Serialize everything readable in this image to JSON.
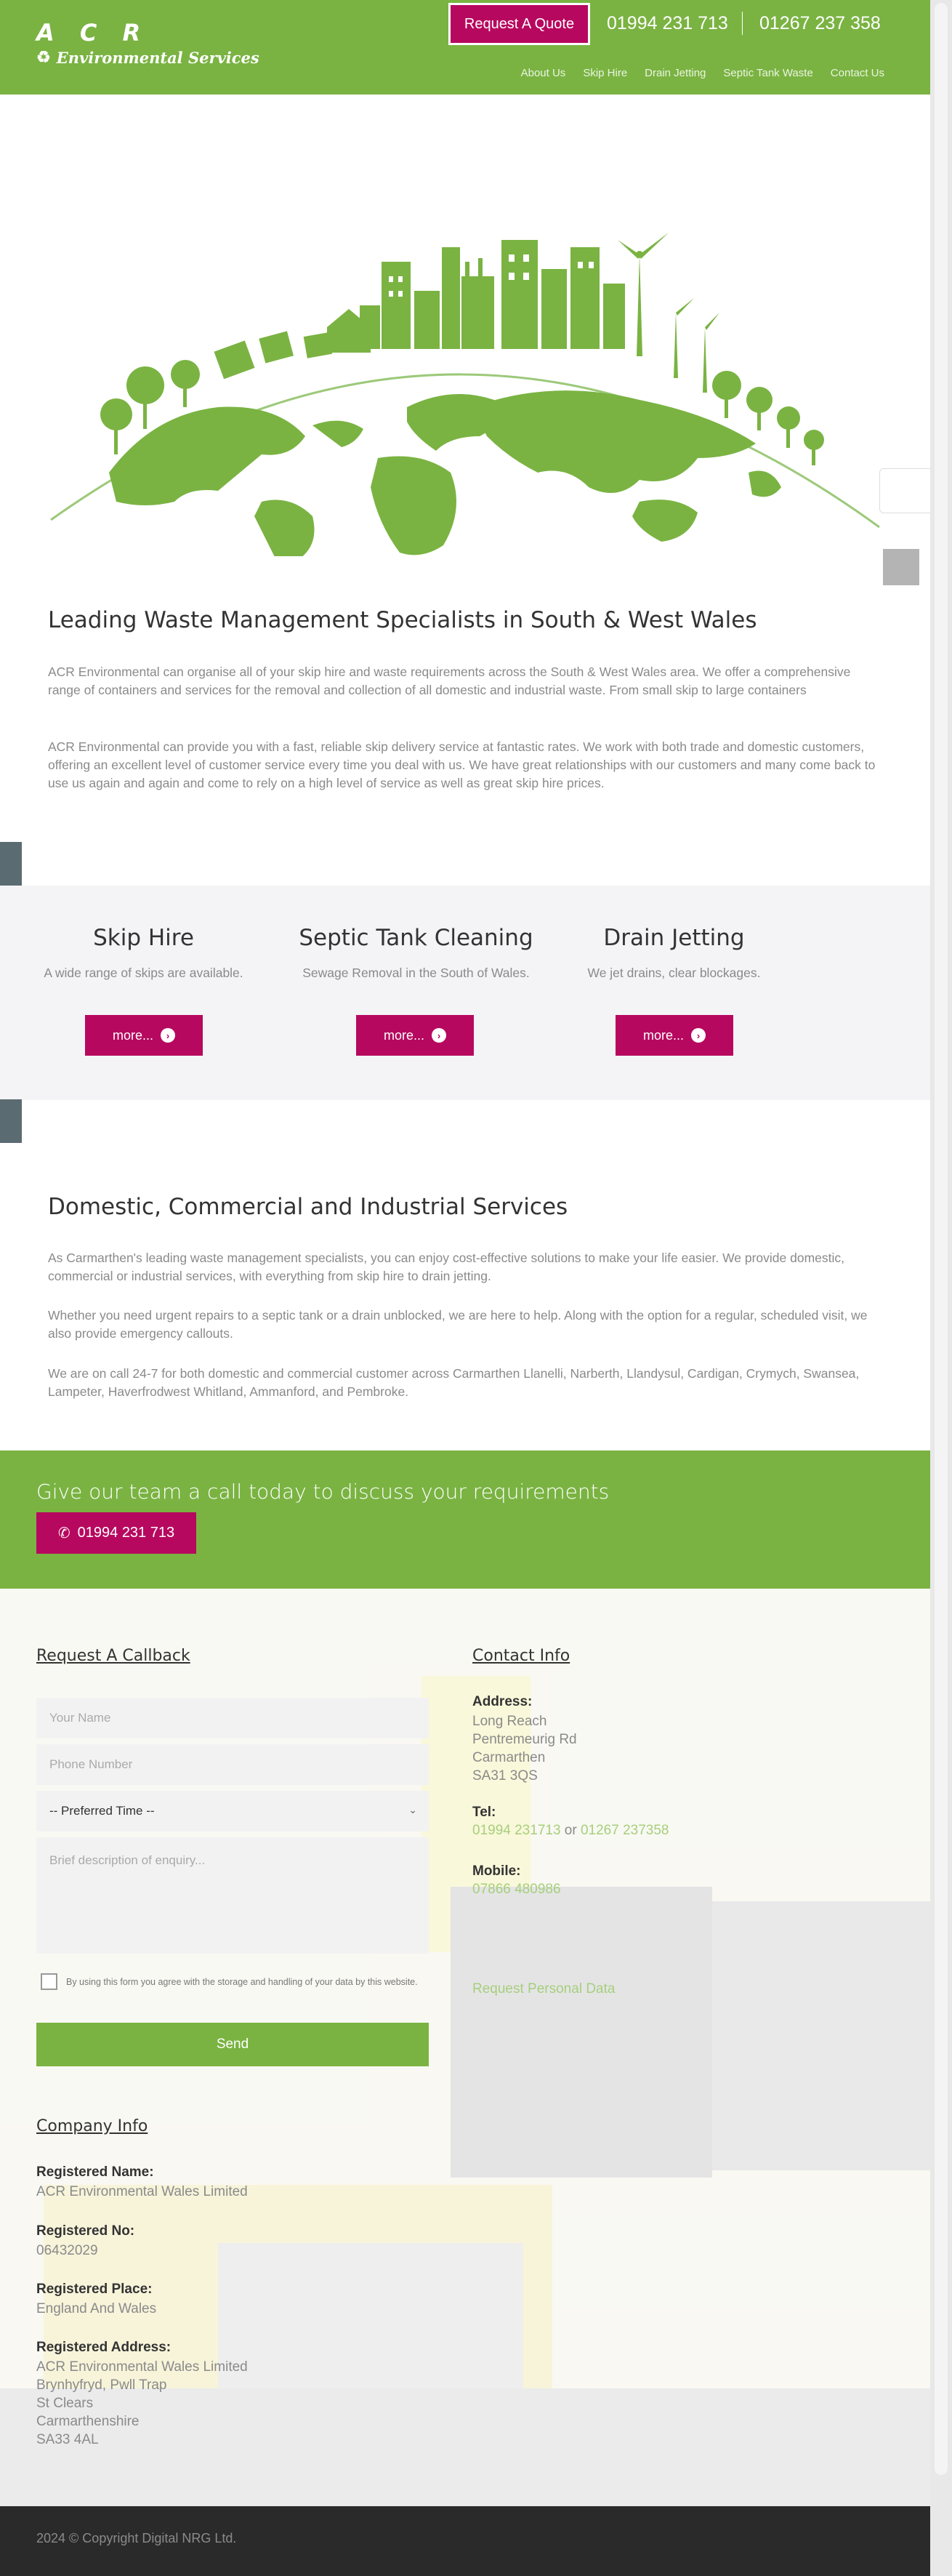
{
  "header": {
    "logo_line1": "A C R",
    "logo_line2": "Environmental Services",
    "quote_button": "Request A Quote",
    "phone1": "01994 231 713",
    "phone2": "01267 237 358",
    "nav": [
      "About Us",
      "Skip Hire",
      "Drain Jetting",
      "Septic Tank Waste",
      "Contact Us"
    ]
  },
  "intro": {
    "title": "Leading Waste Management Specialists in South & West Wales",
    "p1": "ACR Environmental can organise all of your skip hire and waste requirements across the South & West Wales area. We offer a comprehensive range of containers and services for the removal and collection of all domestic and industrial waste. From small skip to large containers",
    "p2": "ACR Environmental can provide you with a fast, reliable skip delivery service at fantastic rates. We work with both trade and domestic customers, offering an excellent level of customer service every time you deal with us. We have great relationships with our customers and many come back to use us again and again and come to rely on a high level of service as well as great skip hire prices."
  },
  "services": [
    {
      "title": "Skip Hire",
      "desc": "A wide range of skips are available.",
      "button": "more..."
    },
    {
      "title": "Septic Tank Cleaning",
      "desc": "Sewage Removal in the South of Wales.",
      "button": "more..."
    },
    {
      "title": "Drain Jetting",
      "desc": "We jet drains, clear blockages.",
      "button": "more..."
    }
  ],
  "domestic": {
    "title": "Domestic, Commercial and Industrial Services",
    "p1": "As Carmarthen's leading waste management specialists, you can enjoy cost-effective solutions to make your life easier. We provide domestic, commercial or industrial services, with everything from skip hire to drain jetting.",
    "p2": "Whether you need urgent repairs to a septic tank or a drain unblocked, we are here to help. Along with the option for a regular, scheduled visit, we also provide emergency callouts.",
    "p3": "We are on call 24-7 for both domestic and commercial customer across Carmarthen Llanelli, Narberth, Llandysul, Cardigan, Crymych, Swansea, Lampeter, Haverfrodwest Whitland, Ammanford, and Pembroke."
  },
  "cta": {
    "text": "Give our team a call today to discuss your requirements",
    "button": "01994 231 713"
  },
  "callback": {
    "title": "Request A Callback",
    "name_placeholder": "Your Name",
    "phone_placeholder": "Phone Number",
    "time_select": "-- Preferred Time --",
    "message_placeholder": "Brief description of enquiry...",
    "consent": "By using this form you agree with the storage and handling of your data by this website.",
    "send": "Send"
  },
  "contact": {
    "title": "Contact Info",
    "address_label": "Address:",
    "address": [
      "Long Reach",
      "Pentremeurig Rd",
      "Carmarthen",
      "SA31 3QS"
    ],
    "tel_label": "Tel:",
    "tel1": "01994 231713",
    "tel_or": "or",
    "tel2": "01267 237358",
    "mobile_label": "Mobile:",
    "mobile": "07866 480986",
    "personal_data": "Request Personal Data"
  },
  "company": {
    "title": "Company Info",
    "reg_name_label": "Registered Name:",
    "reg_name": "ACR Environmental Wales Limited",
    "reg_no_label": "Registered No:",
    "reg_no": "06432029",
    "reg_place_label": "Registered Place:",
    "reg_place": "England And Wales",
    "reg_address_label": "Registered Address:",
    "reg_address": [
      "ACR Environmental Wales Limited",
      "Brynhyfryd, Pwll Trap",
      "St Clears",
      "Carmarthenshire",
      "SA33 4AL"
    ]
  },
  "footer": {
    "copyright": "2024 © Copyright Digital NRG Ltd."
  },
  "colors": {
    "brand_green": "#7ab342",
    "accent_magenta": "#b7085f",
    "footer_dark": "#2a2a2a"
  }
}
